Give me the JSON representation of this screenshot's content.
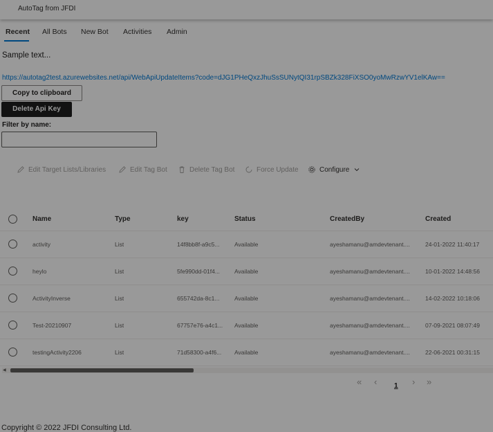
{
  "header": {
    "title": "AutoTag from JFDI"
  },
  "nav": {
    "tabs": [
      "Recent",
      "All Bots",
      "New Bot",
      "Activities",
      "Admin"
    ],
    "active": "Recent"
  },
  "main": {
    "sample_text": "Sample text...",
    "api_url": "https://autotag2test.azurewebsites.net/api/WebApiUpdateItems?code=dJG1PHeQxzJhuSsSUNytQI31rpSBZk328FiXSO0yoMwRzwYV1elKAw==",
    "copy_button": "Copy to clipboard",
    "delete_button": "Delete Api Key",
    "filter_label": "Filter by name:",
    "filter_value": ""
  },
  "commands": {
    "edit_target": "Edit Target Lists/Libraries",
    "edit_tag_bot": "Edit Tag Bot",
    "delete_tag_bot": "Delete Tag Bot",
    "force_update": "Force Update",
    "configure": "Configure"
  },
  "table": {
    "columns": [
      "Name",
      "Type",
      "key",
      "Status",
      "CreatedBy",
      "Created"
    ],
    "rows": [
      [
        "activity",
        "List",
        "14f8bb8f-a9c5...",
        "Available",
        "ayeshamanu@amdevtenant....",
        "24-01-2022 11:40:17"
      ],
      [
        "heylo",
        "List",
        "5fe990dd-01f4...",
        "Available",
        "ayeshamanu@amdevtenant....",
        "10-01-2022 14:48:56"
      ],
      [
        "ActivityInverse",
        "List",
        "655742da-8c1...",
        "Available",
        "ayeshamanu@amdevtenant....",
        "14-02-2022 10:18:06"
      ],
      [
        "Test-20210907",
        "List",
        "67757e76-a4c1...",
        "Available",
        "ayeshamanu@amdevtenant....",
        "07-09-2021 08:07:49"
      ],
      [
        "testingActivity2206",
        "List",
        "71d58300-a4f6...",
        "Available",
        "ayeshamanu@amdevtenant....",
        "22-06-2021 00:31:15"
      ]
    ]
  },
  "pagination": {
    "first": "«",
    "prev": "‹",
    "current": "1",
    "next": "›",
    "last": "»"
  },
  "footer": {
    "text": "Copyright © 2022 JFDI Consulting Ltd."
  },
  "colors": {
    "accent": "#0078d4",
    "overlay": "rgba(0,0,0,0.40)"
  }
}
